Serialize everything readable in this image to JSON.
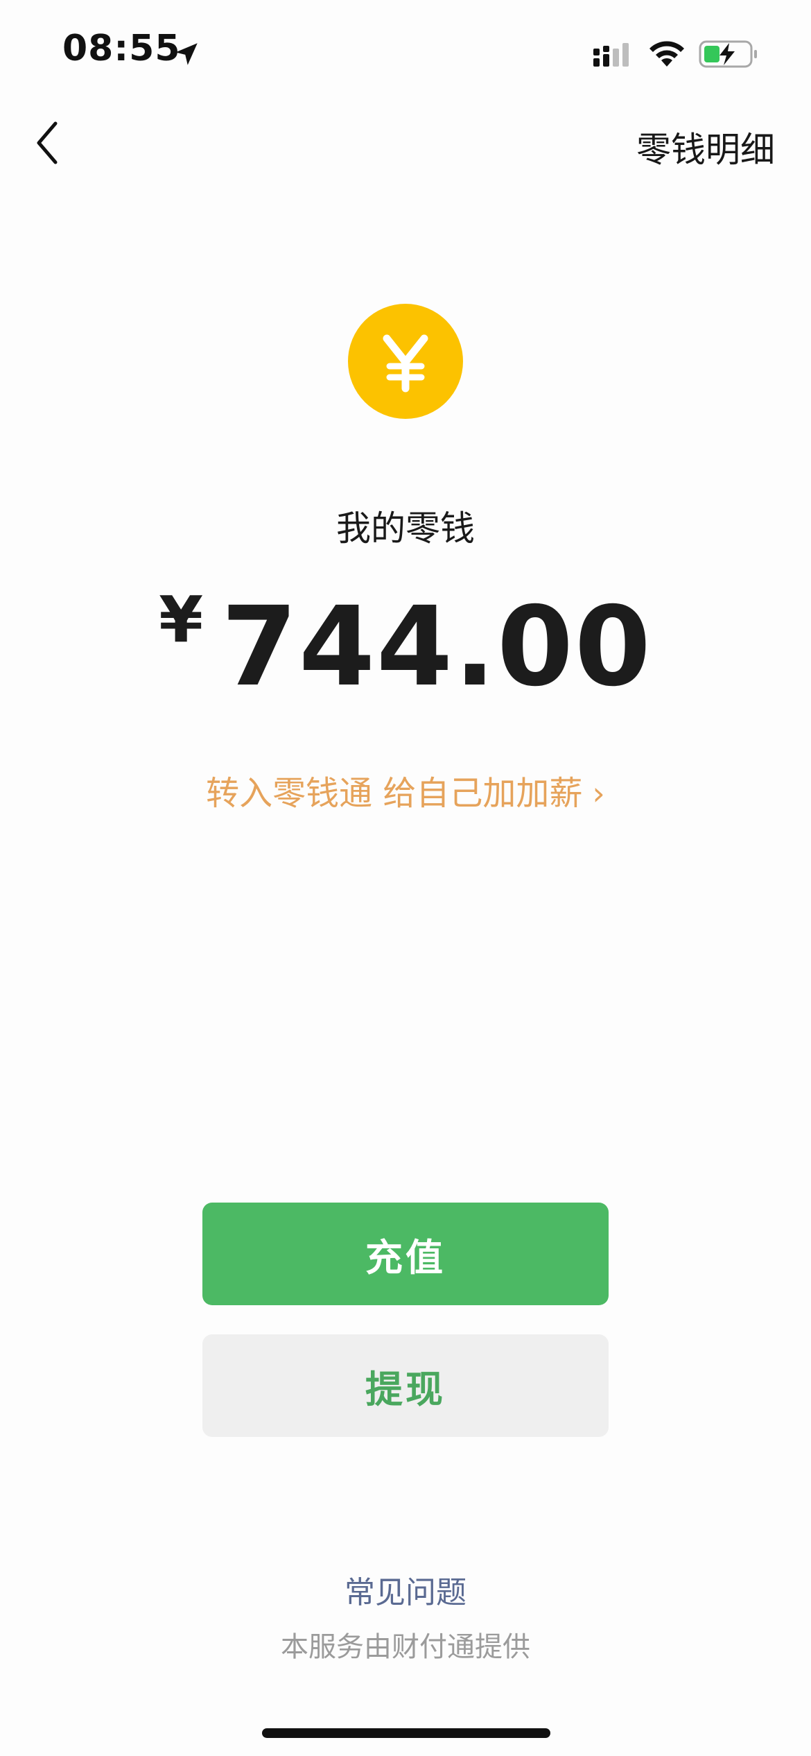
{
  "status_bar": {
    "time": "08:55",
    "location_icon": "location-arrow-icon",
    "signal_icon": "cellular-signal-icon",
    "wifi_icon": "wifi-icon",
    "battery_icon": "battery-charging-icon",
    "battery_level": 0.3
  },
  "nav": {
    "back_icon": "chevron-left-icon",
    "right_link": "零钱明细"
  },
  "balance": {
    "coin_symbol": "¥",
    "label": "我的零钱",
    "currency_sign": "¥",
    "amount": "744.00"
  },
  "promo": {
    "text": "转入零钱通 给自己加加薪",
    "chevron": "›"
  },
  "actions": {
    "recharge_label": "充值",
    "withdraw_label": "提现"
  },
  "footer": {
    "faq_label": "常见问题",
    "provider_text": "本服务由财付通提供"
  },
  "colors": {
    "coin": "#fcc200",
    "primary_button": "#4cb964",
    "secondary_button": "#efefef",
    "promo_text": "#e6a35b",
    "faq_text": "#5a6a92"
  }
}
